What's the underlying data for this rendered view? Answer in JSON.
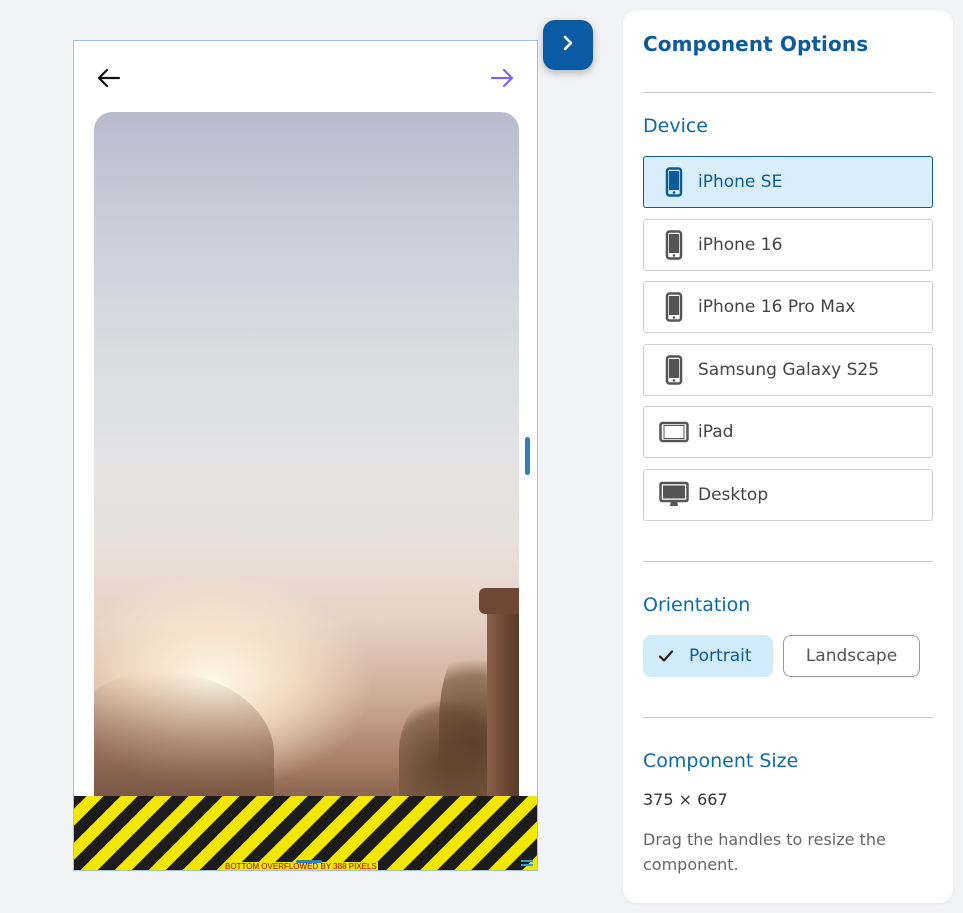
{
  "preview": {
    "nav_back_icon": "arrow-left-icon",
    "nav_forward_icon": "arrow-right-icon",
    "nav_forward_color": "#7b61ff",
    "hero_image": "sunrise-landscape-photo",
    "overflow_warning": "BOTTOM OVERFLOWED BY 388 PIXELS",
    "overflow_colors": {
      "stripe_yellow": "#f1e604",
      "stripe_black": "#1c1c1c",
      "text": "#9a0000"
    }
  },
  "toggle_panel": {
    "icon": "chevron-right-icon",
    "color": "#0a5ba3"
  },
  "panel": {
    "title": "Component Options",
    "device_heading": "Device",
    "devices": [
      {
        "label": "iPhone SE",
        "icon": "phone-icon",
        "selected": true
      },
      {
        "label": "iPhone 16",
        "icon": "phone-icon",
        "selected": false
      },
      {
        "label": "iPhone 16 Pro Max",
        "icon": "phone-icon",
        "selected": false
      },
      {
        "label": "Samsung Galaxy S25",
        "icon": "phone-icon",
        "selected": false
      },
      {
        "label": "iPad",
        "icon": "tablet-icon",
        "selected": false
      },
      {
        "label": "Desktop",
        "icon": "desktop-icon",
        "selected": false
      }
    ],
    "orientation_heading": "Orientation",
    "orientation": {
      "portrait_label": "Portrait",
      "landscape_label": "Landscape",
      "selected": "Portrait"
    },
    "size_heading": "Component Size",
    "size_value": "375 × 667",
    "size_hint": "Drag the handles to resize the component."
  },
  "colors": {
    "accent": "#0b5c99",
    "selected_bg": "#daeefa",
    "page_bg": "#f2f3f5"
  }
}
